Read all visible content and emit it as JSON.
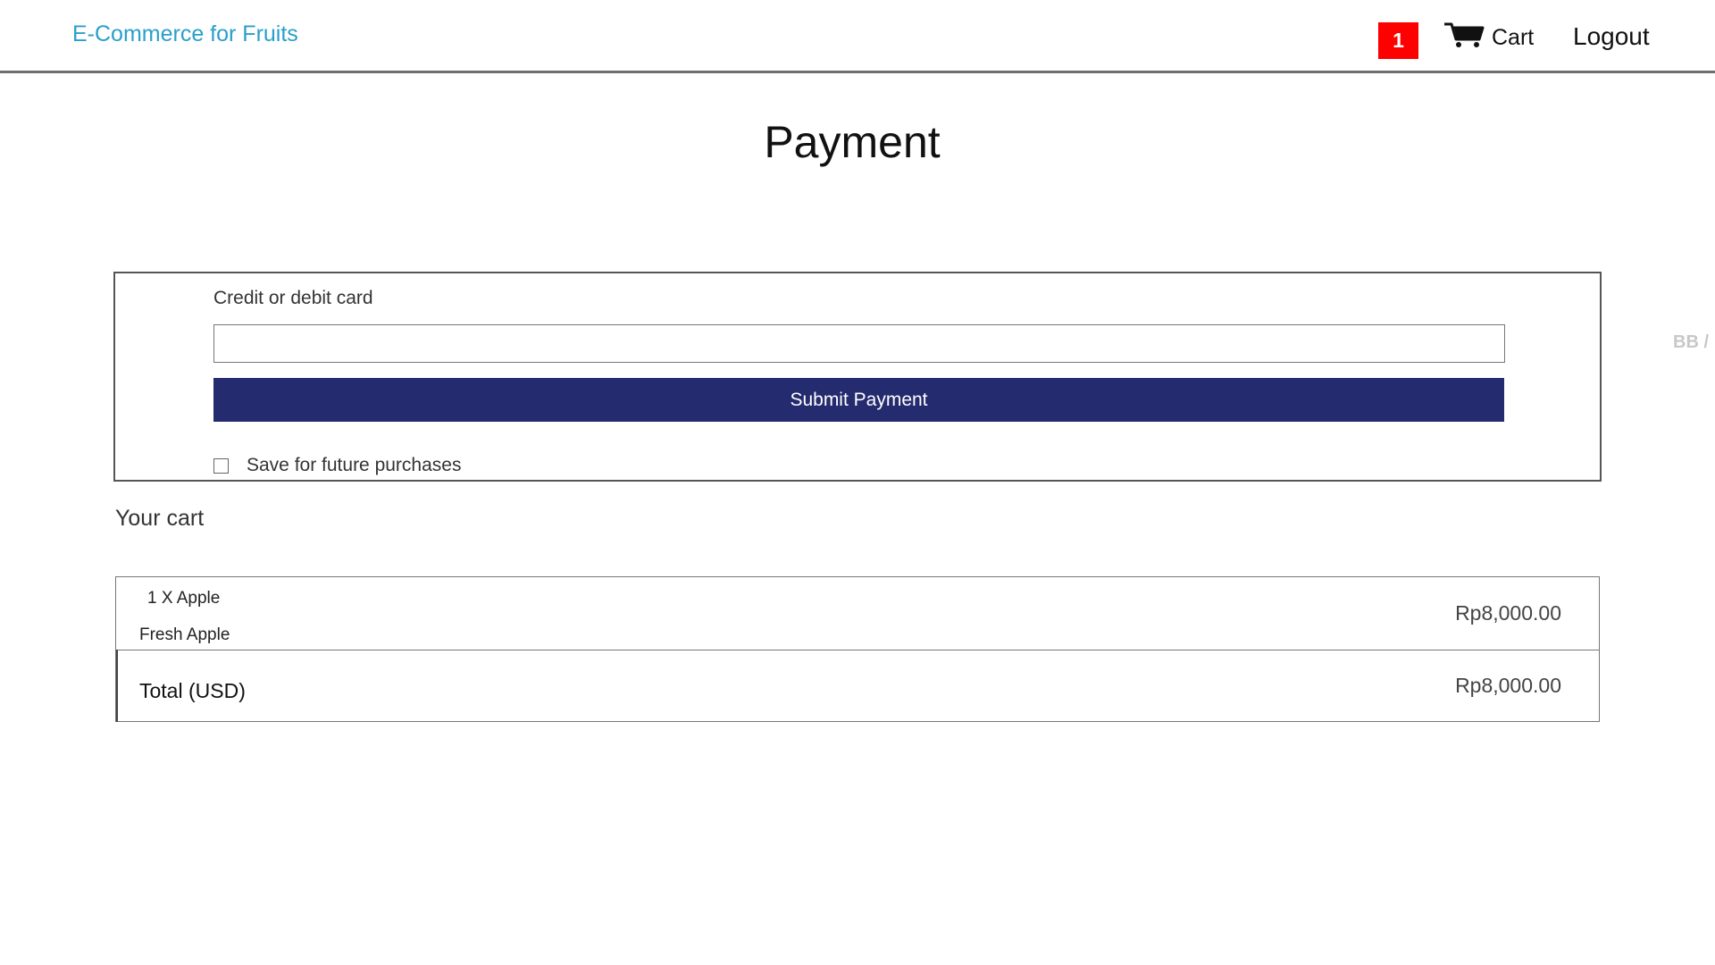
{
  "navbar": {
    "brand": "E-Commerce for Fruits",
    "cart_count": "1",
    "cart_label": "Cart",
    "logout_label": "Logout"
  },
  "page": {
    "title": "Payment",
    "side_note": "BB /"
  },
  "payment_form": {
    "card_label": "Credit or debit card",
    "card_input_value": "",
    "submit_label": "Submit Payment",
    "save_label": "Save for future purchases",
    "save_checked": false
  },
  "cart": {
    "heading": "Your cart",
    "items": [
      {
        "quantity_name": "1 X Apple",
        "description": "Fresh Apple",
        "price": "Rp8,000.00"
      }
    ],
    "total_label": "Total (USD)",
    "total_value": "Rp8,000.00"
  },
  "colors": {
    "brand": "#2a9fc9",
    "badge": "#ff0000",
    "submit_button": "#242b6e"
  },
  "icons": {
    "cart": "shopping-cart-icon"
  }
}
